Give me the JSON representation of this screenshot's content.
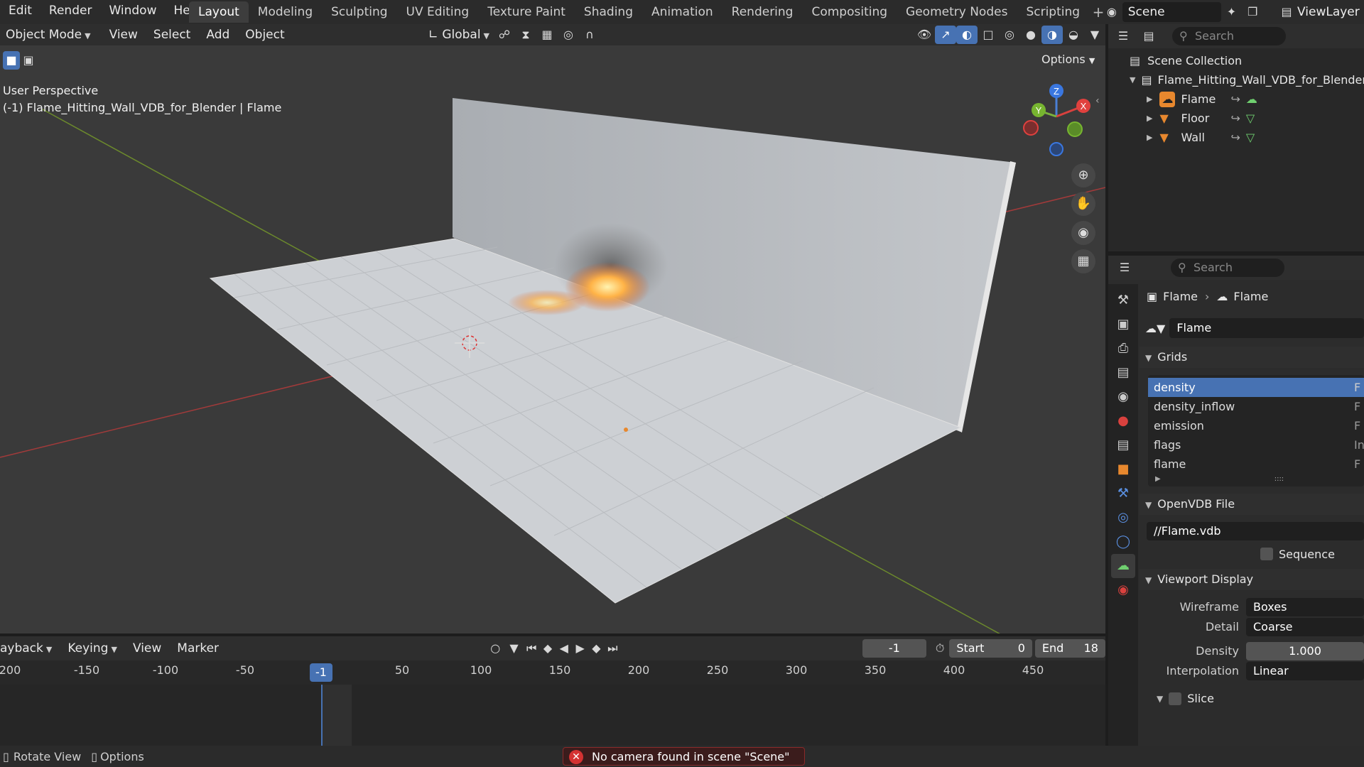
{
  "menu": [
    "Edit",
    "Render",
    "Window",
    "Help"
  ],
  "workspaces": [
    "Layout",
    "Modeling",
    "Sculpting",
    "UV Editing",
    "Texture Paint",
    "Shading",
    "Animation",
    "Rendering",
    "Compositing",
    "Geometry Nodes",
    "Scripting"
  ],
  "scene": "Scene",
  "view_layer": "ViewLayer",
  "viewport": {
    "mode": "Object Mode",
    "menus": [
      "View",
      "Select",
      "Add",
      "Object"
    ],
    "orientation": "Global",
    "options": "Options",
    "overlay_line1": "User Perspective",
    "overlay_line2": "(-1) Flame_Hitting_Wall_VDB_for_Blender | Flame",
    "gizmo": {
      "x": "X",
      "y": "Y",
      "z": "Z"
    }
  },
  "outliner": {
    "search_placeholder": "Search",
    "root": "Scene Collection",
    "collection": "Flame_Hitting_Wall_VDB_for_Blender",
    "objects": [
      "Flame",
      "Floor",
      "Wall"
    ]
  },
  "properties": {
    "search_placeholder": "Search",
    "breadcrumb_object": "Flame",
    "breadcrumb_data": "Flame",
    "datablock": "Flame",
    "grids_title": "Grids",
    "grids": [
      {
        "name": "density",
        "type": "F"
      },
      {
        "name": "density_inflow",
        "type": "F"
      },
      {
        "name": "emission",
        "type": "F"
      },
      {
        "name": "flags",
        "type": "Int"
      },
      {
        "name": "flame",
        "type": "F"
      }
    ],
    "openvdb_title": "OpenVDB File",
    "file_path": "//Flame.vdb",
    "sequence_label": "Sequence",
    "viewport_display_title": "Viewport Display",
    "wireframe_label": "Wireframe",
    "wireframe_value": "Boxes",
    "detail_label": "Detail",
    "detail_value": "Coarse",
    "density_label": "Density",
    "density_value": "1.000",
    "interpolation_label": "Interpolation",
    "interpolation_value": "Linear",
    "slice_label": "Slice"
  },
  "timeline": {
    "menus": [
      "ayback",
      "Keying",
      "View",
      "Marker"
    ],
    "current_frame": "-1",
    "start_label": "Start",
    "start_value": "0",
    "end_label": "End",
    "end_value": "18",
    "ruler": [
      "200",
      "-150",
      "-100",
      "-50",
      "-1",
      "50",
      "100",
      "150",
      "200",
      "250",
      "300",
      "350",
      "400",
      "450"
    ]
  },
  "status": {
    "rotate_view": "Rotate View",
    "options": "Options",
    "error": "No camera found in scene \"Scene\""
  },
  "colors": {
    "accent": "#4772b3",
    "error": "#d43232",
    "object_orange": "#e8882e",
    "data_green": "#6fcf6f"
  }
}
